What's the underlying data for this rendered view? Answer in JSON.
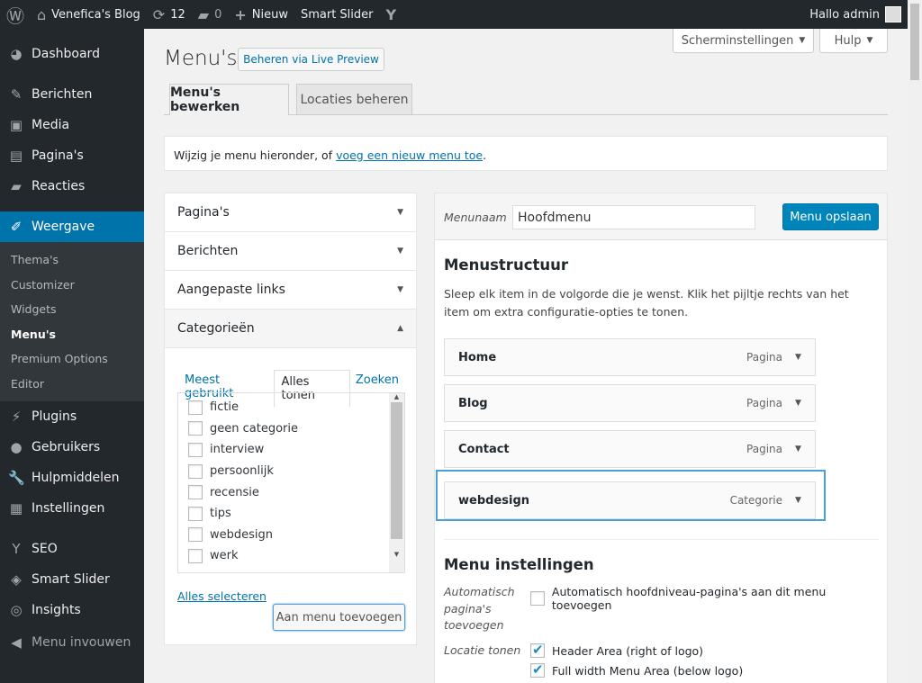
{
  "adminbar": {
    "site": "Venefica's Blog",
    "updates": "12",
    "comments": "0",
    "new": "Nieuw",
    "slider": "Smart Slider",
    "greeting": "Hallo admin"
  },
  "sidebar": {
    "items": [
      {
        "label": "Dashboard",
        "icon": "dashboard-icon",
        "g": "◕"
      },
      {
        "label": "Berichten",
        "icon": "pin-icon",
        "g": "✎"
      },
      {
        "label": "Media",
        "icon": "media-icon",
        "g": "▣"
      },
      {
        "label": "Pagina's",
        "icon": "page-icon",
        "g": "▤"
      },
      {
        "label": "Reacties",
        "icon": "comment-icon",
        "g": "▰"
      },
      {
        "label": "Weergave",
        "icon": "appearance-icon",
        "g": "✐"
      }
    ],
    "submenu": [
      "Thema's",
      "Customizer",
      "Widgets",
      "Menu's",
      "Premium Options",
      "Editor"
    ],
    "items2": [
      {
        "label": "Plugins",
        "icon": "plugin-icon",
        "g": "⚡"
      },
      {
        "label": "Gebruikers",
        "icon": "users-icon",
        "g": "●"
      },
      {
        "label": "Hulpmiddelen",
        "icon": "tools-icon",
        "g": "🔧"
      },
      {
        "label": "Instellingen",
        "icon": "settings-icon",
        "g": "▦"
      },
      {
        "label": "SEO",
        "icon": "yoast-icon",
        "g": "Y"
      },
      {
        "label": "Smart Slider",
        "icon": "slider-icon",
        "g": "◈"
      },
      {
        "label": "Insights",
        "icon": "insights-icon",
        "g": "◎"
      },
      {
        "label": "Menu invouwen",
        "icon": "collapse-icon",
        "g": "◀"
      }
    ]
  },
  "header": {
    "title": "Menu's",
    "live_preview": "Beheren via Live Preview",
    "screen_options": "Scherminstellingen",
    "help": "Hulp"
  },
  "tabs": [
    "Menu's bewerken",
    "Locaties beheren"
  ],
  "notice": {
    "text": "Wijzig je menu hieronder, of ",
    "link": "voeg een nieuw menu toe",
    "end": "."
  },
  "accordion": [
    "Pagina's",
    "Berichten",
    "Aangepaste links",
    "Categorieën"
  ],
  "cat_tabs": [
    "Meest gebruikt",
    "Alles tonen",
    "Zoeken"
  ],
  "categories": [
    "fictie",
    "geen categorie",
    "interview",
    "persoonlijk",
    "recensie",
    "tips",
    "webdesign",
    "werk"
  ],
  "select_all": "Alles selecteren",
  "add_to_menu": "Aan menu toevoegen",
  "menu": {
    "name_label": "Menunaam",
    "name_value": "Hoofdmenu",
    "save": "Menu opslaan",
    "structure_title": "Menustructuur",
    "structure_help": "Sleep elk item in de volgorde die je wenst. Klik het pijltje rechts van het item om extra configuratie-opties te tonen.",
    "items": [
      {
        "label": "Home",
        "type": "Pagina"
      },
      {
        "label": "Blog",
        "type": "Pagina"
      },
      {
        "label": "Contact",
        "type": "Pagina"
      },
      {
        "label": "webdesign",
        "type": "Categorie"
      }
    ],
    "settings_title": "Menu instellingen",
    "auto_label": "Automatisch pagina's toevoegen",
    "auto_option": "Automatisch hoofdniveau-pagina's aan dit menu toevoegen",
    "loc_label": "Locatie tonen",
    "locations": [
      "Header Area (right of logo)",
      "Full width Menu Area (below logo)"
    ]
  },
  "colors": {
    "accent": "#0073aa",
    "adminbar": "#23282d",
    "highlight": "#5b9dd9"
  }
}
